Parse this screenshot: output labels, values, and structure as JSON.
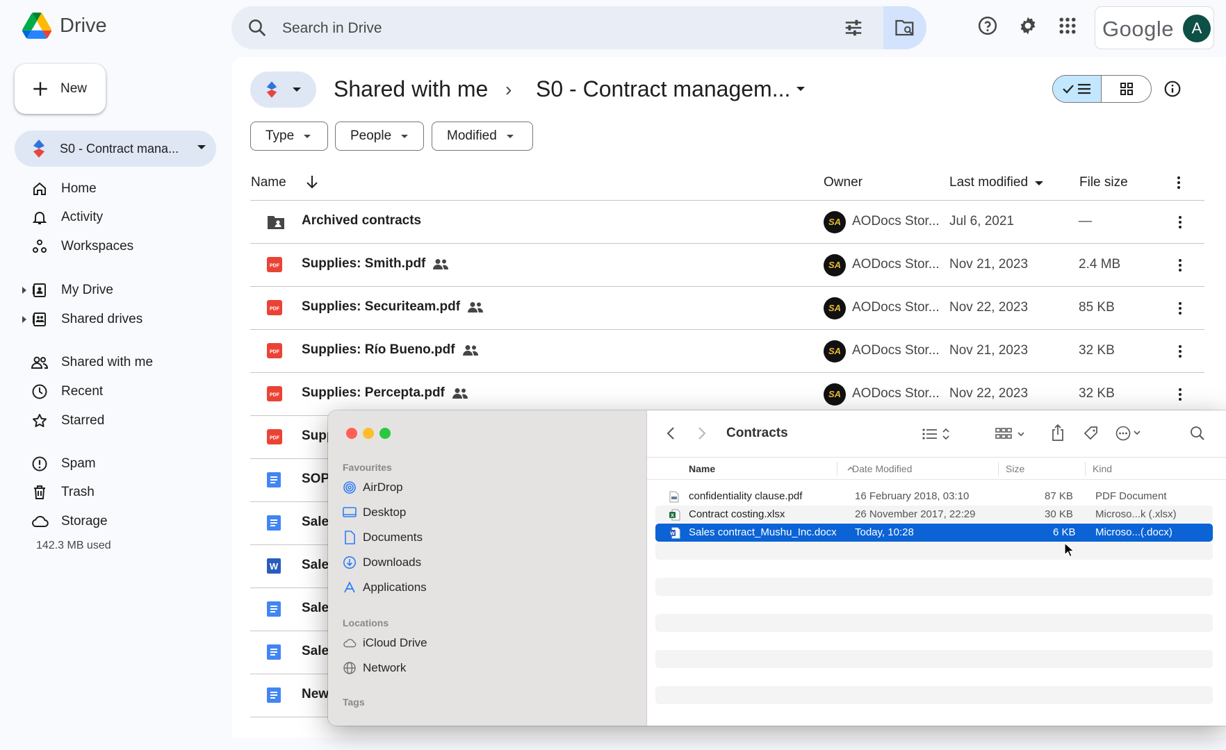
{
  "drive": {
    "app_name": "Drive",
    "search": {
      "placeholder": "Search in Drive"
    },
    "account": {
      "brand": "Google",
      "avatar_letter": "A"
    },
    "new_button": "New",
    "workspace_chip": "S0 - Contract mana...",
    "nav": {
      "home": "Home",
      "activity": "Activity",
      "workspaces": "Workspaces",
      "my_drive": "My Drive",
      "shared_drives": "Shared drives",
      "shared_with_me": "Shared with me",
      "recent": "Recent",
      "starred": "Starred",
      "spam": "Spam",
      "trash": "Trash",
      "storage": "Storage",
      "storage_used": "142.3 MB used"
    },
    "breadcrumb": {
      "root": "Shared with me",
      "separator": "›",
      "current": "S0 - Contract managem..."
    },
    "filters": {
      "type": "Type",
      "people": "People",
      "modified": "Modified"
    },
    "columns": {
      "name": "Name",
      "owner": "Owner",
      "last_modified": "Last modified",
      "file_size": "File size"
    },
    "rows": [
      {
        "name": "Archived contracts",
        "owner": "AODocs Stor...",
        "modified": "Jul 6, 2021",
        "size": "—"
      },
      {
        "name": "Supplies: Smith.pdf",
        "owner": "AODocs Stor...",
        "modified": "Nov 21, 2023",
        "size": "2.4 MB"
      },
      {
        "name": "Supplies: Securiteam.pdf",
        "owner": "AODocs Stor...",
        "modified": "Nov 22, 2023",
        "size": "85 KB"
      },
      {
        "name": "Supplies: Río Bueno.pdf",
        "owner": "AODocs Stor...",
        "modified": "Nov 21, 2023",
        "size": "32 KB"
      },
      {
        "name": "Supplies: Percepta.pdf",
        "owner": "AODocs Stor...",
        "modified": "Nov 22, 2023",
        "size": "32 KB"
      },
      {
        "name": "Supp"
      },
      {
        "name": "SOP"
      },
      {
        "name": "Sales"
      },
      {
        "name": "Sales"
      },
      {
        "name": "Sales"
      },
      {
        "name": "Sales"
      },
      {
        "name": "New"
      }
    ],
    "owner_avatar_text": "SA"
  },
  "finder": {
    "title": "Contracts",
    "sidebar": {
      "favourites_label": "Favourites",
      "airdrop": "AirDrop",
      "desktop": "Desktop",
      "documents": "Documents",
      "downloads": "Downloads",
      "applications": "Applications",
      "locations_label": "Locations",
      "icloud": "iCloud Drive",
      "network": "Network",
      "tags_label": "Tags"
    },
    "columns": {
      "name": "Name",
      "date": "Date Modified",
      "size": "Size",
      "kind": "Kind"
    },
    "files": [
      {
        "name": "confidentiality clause.pdf",
        "date": "16 February 2018, 03:10",
        "size": "87 KB",
        "kind": "PDF Document"
      },
      {
        "name": "Contract costing.xlsx",
        "date": "26 November 2017, 22:29",
        "size": "30 KB",
        "kind": "Microso...k (.xlsx)"
      },
      {
        "name": "Sales contract_Mushu_Inc.docx",
        "date": "Today, 10:28",
        "size": "6 KB",
        "kind": "Microso...(.docx)"
      }
    ]
  },
  "colors": {
    "accent_blue": "#0b57d0",
    "pdf_red": "#ea4335",
    "finder_selection": "#0b63d6",
    "chip_blue": "#c2e7ff"
  }
}
